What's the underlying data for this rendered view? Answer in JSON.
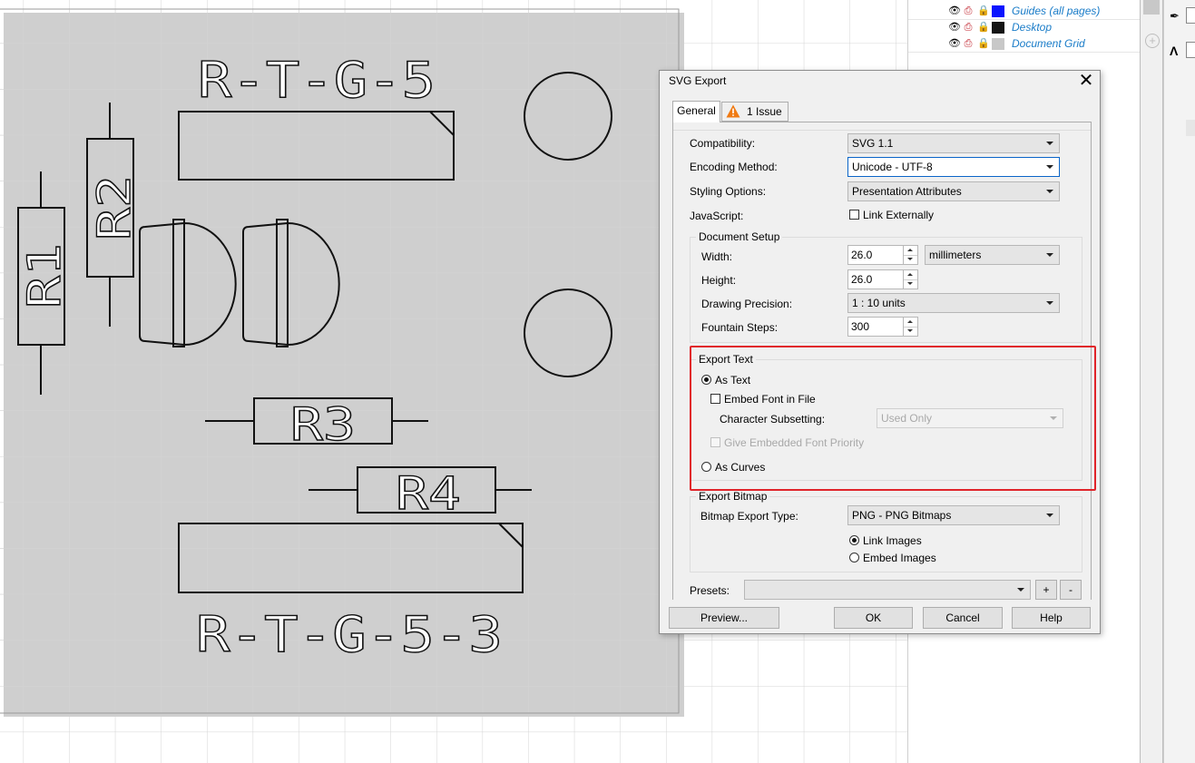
{
  "object_manager": {
    "layers": [
      {
        "name": "Guides (all pages)",
        "swatch": "#0a14ff"
      },
      {
        "name": "Desktop",
        "swatch": "#141414"
      },
      {
        "name": "Document Grid",
        "swatch": "#c8c8c8"
      }
    ],
    "eye_glyph": "👁",
    "lock_glyph": "🔒"
  },
  "drawing": {
    "labels": {
      "top": "R-T-G-5",
      "bottom": "R-T-G-5-3",
      "r1": "R1",
      "r2": "R2",
      "r3": "R3",
      "r4": "R4"
    }
  },
  "dialog": {
    "title": "SVG Export",
    "close_glyph": "✕",
    "tabs": {
      "general": "General",
      "issues": "1 Issue"
    },
    "fields": {
      "compatibility_label": "Compatibility:",
      "compatibility_value": "SVG 1.1",
      "encoding_label": "Encoding Method:",
      "encoding_value": "Unicode - UTF-8",
      "styling_label": "Styling Options:",
      "styling_value": "Presentation Attributes",
      "javascript_label": "JavaScript:",
      "link_externally_label": "Link Externally"
    },
    "document_setup": {
      "title": "Document Setup",
      "width_label": "Width:",
      "width_value": "26.0",
      "units_value": "millimeters",
      "height_label": "Height:",
      "height_value": "26.0",
      "precision_label": "Drawing Precision:",
      "precision_value": "1 : 10 units",
      "fountain_label": "Fountain Steps:",
      "fountain_value": "300"
    },
    "export_text": {
      "title": "Export Text",
      "as_text_label": "As Text",
      "embed_font_label": "Embed Font in File",
      "subsetting_label": "Character Subsetting:",
      "subsetting_value": "Used Only",
      "give_priority_label": "Give Embedded Font Priority",
      "as_curves_label": "As Curves"
    },
    "export_bitmap": {
      "title": "Export Bitmap",
      "type_label": "Bitmap Export Type:",
      "type_value": "PNG - PNG Bitmaps",
      "link_images_label": "Link Images",
      "embed_images_label": "Embed Images"
    },
    "presets": {
      "label": "Presets:",
      "value": "",
      "add_label": "+",
      "remove_label": "-"
    },
    "buttons": {
      "preview": "Preview...",
      "ok": "OK",
      "cancel": "Cancel",
      "help": "Help"
    }
  }
}
